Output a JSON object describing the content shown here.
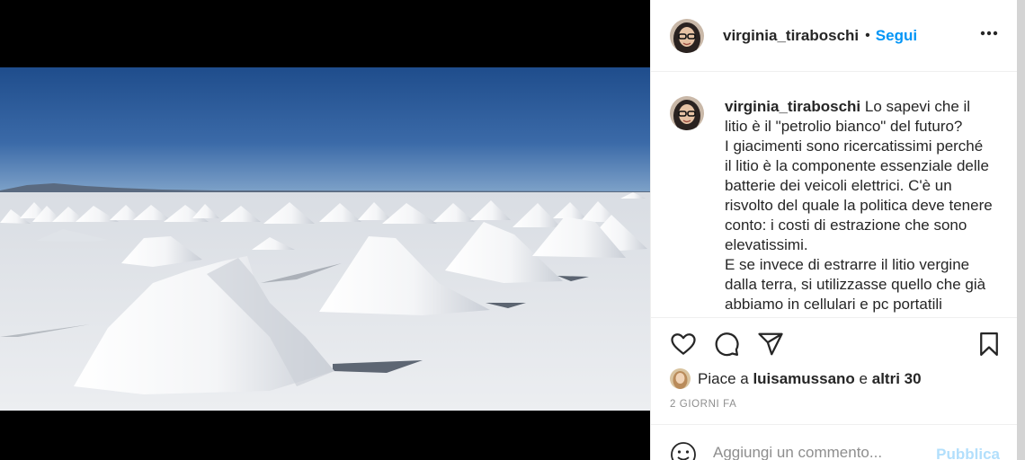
{
  "post": {
    "image": "salt-flat-mounds-photo",
    "author": "virginia_tiraboschi",
    "follow_separator": "•",
    "follow_label": "Segui",
    "more_icon": "more-horizontal-icon",
    "caption": {
      "author": "virginia_tiraboschi",
      "lines": [
        "Lo sapevi che il litio è il \"petrolio bianco\" del futuro?",
        "I giacimenti sono ricercatissimi perché il litio è la componente essenziale delle batterie dei veicoli elettrici. C'è un risvolto del quale la politica deve tenere conto: i costi di estrazione che sono elevatissimi.",
        "E se invece di estrarre il litio vergine dalla terra, si utilizzasse quello che già abbiamo in cellulari e pc portatili"
      ]
    },
    "actions": {
      "like_icon": "heart-icon",
      "comment_icon": "comment-bubble-icon",
      "share_icon": "paper-plane-icon",
      "save_icon": "bookmark-icon"
    },
    "likes": {
      "prefix": "Piace a",
      "user": "luisamussano",
      "conjunction": "e",
      "others": "altri 30"
    },
    "timestamp": "2 GIORNI FA",
    "comment": {
      "emoji_icon": "smiley-icon",
      "placeholder": "Aggiungi un commento...",
      "publish_label": "Pubblica"
    }
  },
  "colors": {
    "link_blue": "#0095f6",
    "publish_disabled": "#b2dffc",
    "text": "#262626",
    "muted": "#8e8e8e"
  }
}
